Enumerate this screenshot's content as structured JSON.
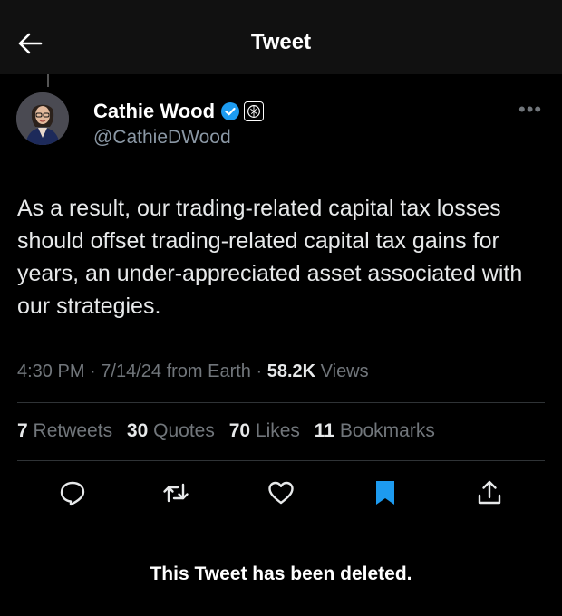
{
  "header": {
    "title": "Tweet"
  },
  "author": {
    "name": "Cathie Wood",
    "handle": "@CathieDWood"
  },
  "tweet": {
    "text": "As a result, our trading-related capital tax losses should offset trading-related capital tax gains for years, an under-appreciated asset associated with our strategies.",
    "time": "4:30 PM",
    "date": "7/14/24",
    "source": "from Earth",
    "views_count": "58.2K",
    "views_label": "Views"
  },
  "stats": {
    "retweets_count": "7",
    "retweets_label": "Retweets",
    "quotes_count": "30",
    "quotes_label": "Quotes",
    "likes_count": "70",
    "likes_label": "Likes",
    "bookmarks_count": "11",
    "bookmarks_label": "Bookmarks"
  },
  "actions": {
    "reply_icon": "reply-icon",
    "retweet_icon": "retweet-icon",
    "like_icon": "heart-icon",
    "bookmark_icon": "bookmark-icon",
    "share_icon": "share-icon",
    "bookmark_active_color": "#1d9bf0"
  },
  "deleted_notice": "This Tweet has been deleted."
}
